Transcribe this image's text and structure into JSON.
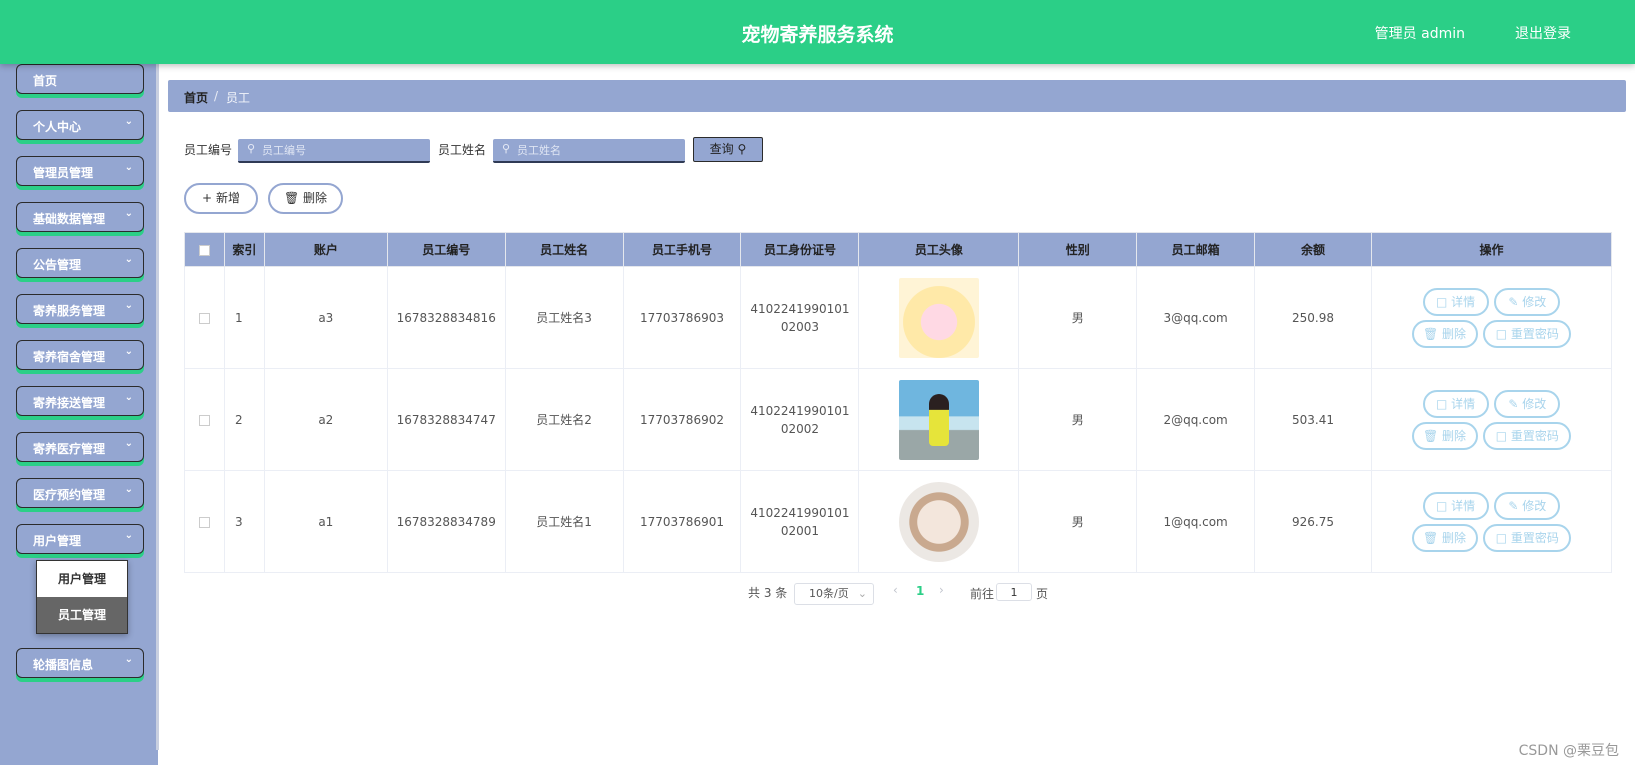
{
  "header": {
    "title": "宠物寄养服务系统",
    "user": "管理员 admin",
    "logout": "退出登录"
  },
  "sidebar": {
    "items": [
      {
        "label": "首页",
        "chevron": false
      },
      {
        "label": "个人中心",
        "chevron": true
      },
      {
        "label": "管理员管理",
        "chevron": true
      },
      {
        "label": "基础数据管理",
        "chevron": true
      },
      {
        "label": "公告管理",
        "chevron": true
      },
      {
        "label": "寄养服务管理",
        "chevron": true
      },
      {
        "label": "寄养宿舍管理",
        "chevron": true
      },
      {
        "label": "寄养接送管理",
        "chevron": true
      },
      {
        "label": "寄养医疗管理",
        "chevron": true
      },
      {
        "label": "医疗预约管理",
        "chevron": true
      },
      {
        "label": "用户管理",
        "chevron": true
      },
      {
        "label": "轮播图信息",
        "chevron": true
      }
    ],
    "submenu": [
      {
        "label": "用户管理",
        "active": false
      },
      {
        "label": "员工管理",
        "active": true
      }
    ]
  },
  "breadcrumb": {
    "home": "首页",
    "current": "员工"
  },
  "search": {
    "no_label": "员工编号",
    "no_placeholder": "员工编号",
    "name_label": "员工姓名",
    "name_placeholder": "员工姓名",
    "query": "查询"
  },
  "actions": {
    "add": "新增",
    "delete": "删除"
  },
  "table": {
    "columns": [
      "索引",
      "账户",
      "员工编号",
      "员工姓名",
      "员工手机号",
      "员工身份证号",
      "员工头像",
      "性别",
      "员工邮箱",
      "余额",
      "操作"
    ],
    "rows": [
      {
        "index": "1",
        "account": "a3",
        "no": "1678328834816",
        "name": "员工姓名3",
        "phone": "17703786903",
        "idcard": "410224199010102003",
        "gender": "男",
        "email": "3@qq.com",
        "balance": "250.98"
      },
      {
        "index": "2",
        "account": "a2",
        "no": "1678328834747",
        "name": "员工姓名2",
        "phone": "17703786902",
        "idcard": "410224199010102002",
        "gender": "男",
        "email": "2@qq.com",
        "balance": "503.41"
      },
      {
        "index": "3",
        "account": "a1",
        "no": "1678328834789",
        "name": "员工姓名1",
        "phone": "17703786901",
        "idcard": "410224199010102001",
        "gender": "男",
        "email": "1@qq.com",
        "balance": "926.75"
      }
    ],
    "ops": {
      "detail": "详情",
      "edit": "修改",
      "delete": "删除",
      "reset": "重置密码"
    }
  },
  "pagination": {
    "total": "共 3 条",
    "page_size": "10条/页",
    "current": "1",
    "goto": "前往",
    "goto_value": "1",
    "unit": "页"
  },
  "watermark": "CSDN @栗豆包"
}
